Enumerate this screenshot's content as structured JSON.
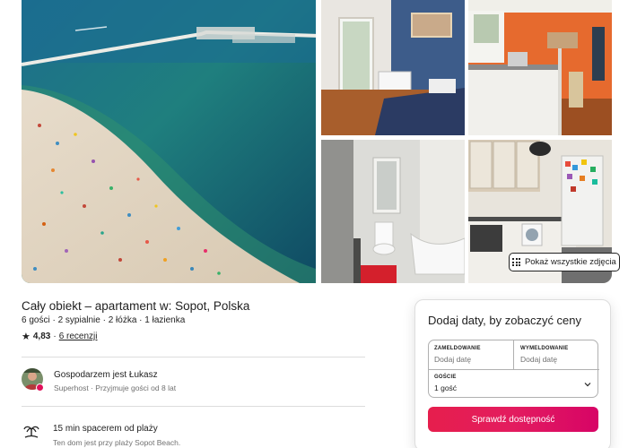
{
  "gallery": {
    "photos": [
      {
        "subject": "aerial-beach-pier"
      },
      {
        "subject": "bedroom"
      },
      {
        "subject": "kitchen-orange-wall"
      },
      {
        "subject": "bathroom"
      },
      {
        "subject": "kitchen-dining"
      }
    ],
    "show_all_label": "Pokaż wszystkie zdjęcia",
    "show_all_icon": "grid-dots-icon"
  },
  "listing": {
    "title": "Cały obiekt – apartament w: Sopot, Polska",
    "meta": "6 gości · 2 sypialnie · 2 łóżka · 1 łazienka",
    "rating": "4,83",
    "rating_separator": "·",
    "reviews_link": "6 recenzji",
    "star_glyph": "★"
  },
  "host": {
    "name_line": "Gospodarzem jest Łukasz",
    "sub_line": "Superhost · Przyjmuje gości od 8 lat"
  },
  "highlight": {
    "title": "15 min spacerem od plaży",
    "sub": "Ten dom jest przy plaży Sopot Beach."
  },
  "booking": {
    "title": "Dodaj daty, by zobaczyć ceny",
    "checkin_label": "ZAMELDOWANIE",
    "checkin_value": "Dodaj datę",
    "checkout_label": "WYMELDOWANIE",
    "checkout_value": "Dodaj datę",
    "guests_label": "GOŚCIE",
    "guests_value": "1 gość",
    "button_label": "Sprawdź dostępność"
  },
  "colors": {
    "brand": "#E31C5F",
    "text": "#222222",
    "muted": "#717171",
    "border": "#DDDDDD"
  }
}
